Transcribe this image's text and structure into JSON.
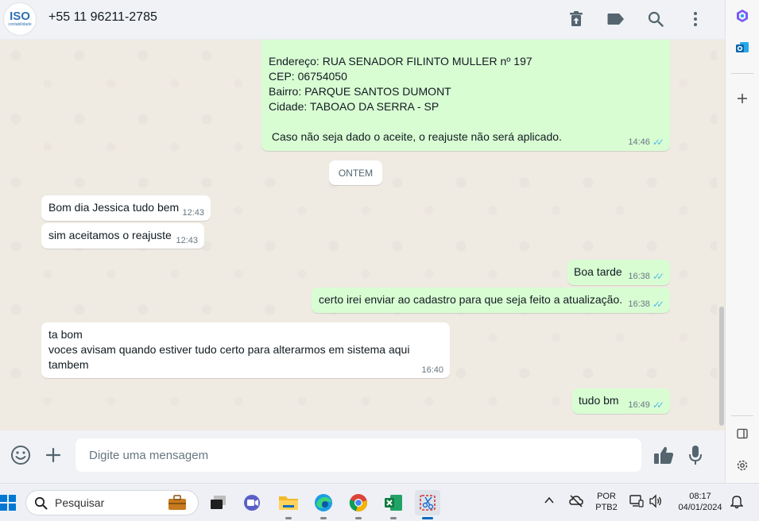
{
  "chat": {
    "contact": "+55 11 96211-2785",
    "avatar_logo": "ISO",
    "avatar_sub": "contabilidade"
  },
  "messages": [
    {
      "dir": "out",
      "text": "Endereço: RUA SENADOR FILINTO MULLER nº 197\nCEP: 06754050\nBairro: PARQUE SANTOS DUMONT\nCidade: TABOAO DA SERRA - SP\n\n Caso não seja dado o aceite, o reajuste não será aplicado.",
      "time": "14:46",
      "read": true
    },
    {
      "dir": "in",
      "text": "Bom dia Jessica tudo bem",
      "time": "12:43"
    },
    {
      "dir": "in",
      "text": "sim aceitamos o reajuste",
      "time": "12:43"
    },
    {
      "dir": "out",
      "text": "Boa tarde",
      "time": "16:38",
      "read": true
    },
    {
      "dir": "out",
      "text": "certo irei enviar ao cadastro para que seja feito a atualização.",
      "time": "16:38",
      "read": true
    },
    {
      "dir": "in",
      "text": "ta bom\nvoces avisam quando estiver tudo certo para alterarmos em sistema aqui tambem",
      "time": "16:40"
    },
    {
      "dir": "out",
      "text": "tudo bm",
      "time": "16:49",
      "read": true
    }
  ],
  "date_separator": "ONTEM",
  "composer": {
    "placeholder": "Digite uma mensagem"
  },
  "taskbar": {
    "search_label": "Pesquisar",
    "lang_top": "POR",
    "lang_bottom": "PTB2",
    "time": "08:17",
    "date": "04/01/2024"
  },
  "colors": {
    "outgoing_bubble": "#d9fdd3",
    "incoming_bubble": "#ffffff",
    "chat_background": "#efeae2",
    "read_ticks": "#53bdeb"
  }
}
